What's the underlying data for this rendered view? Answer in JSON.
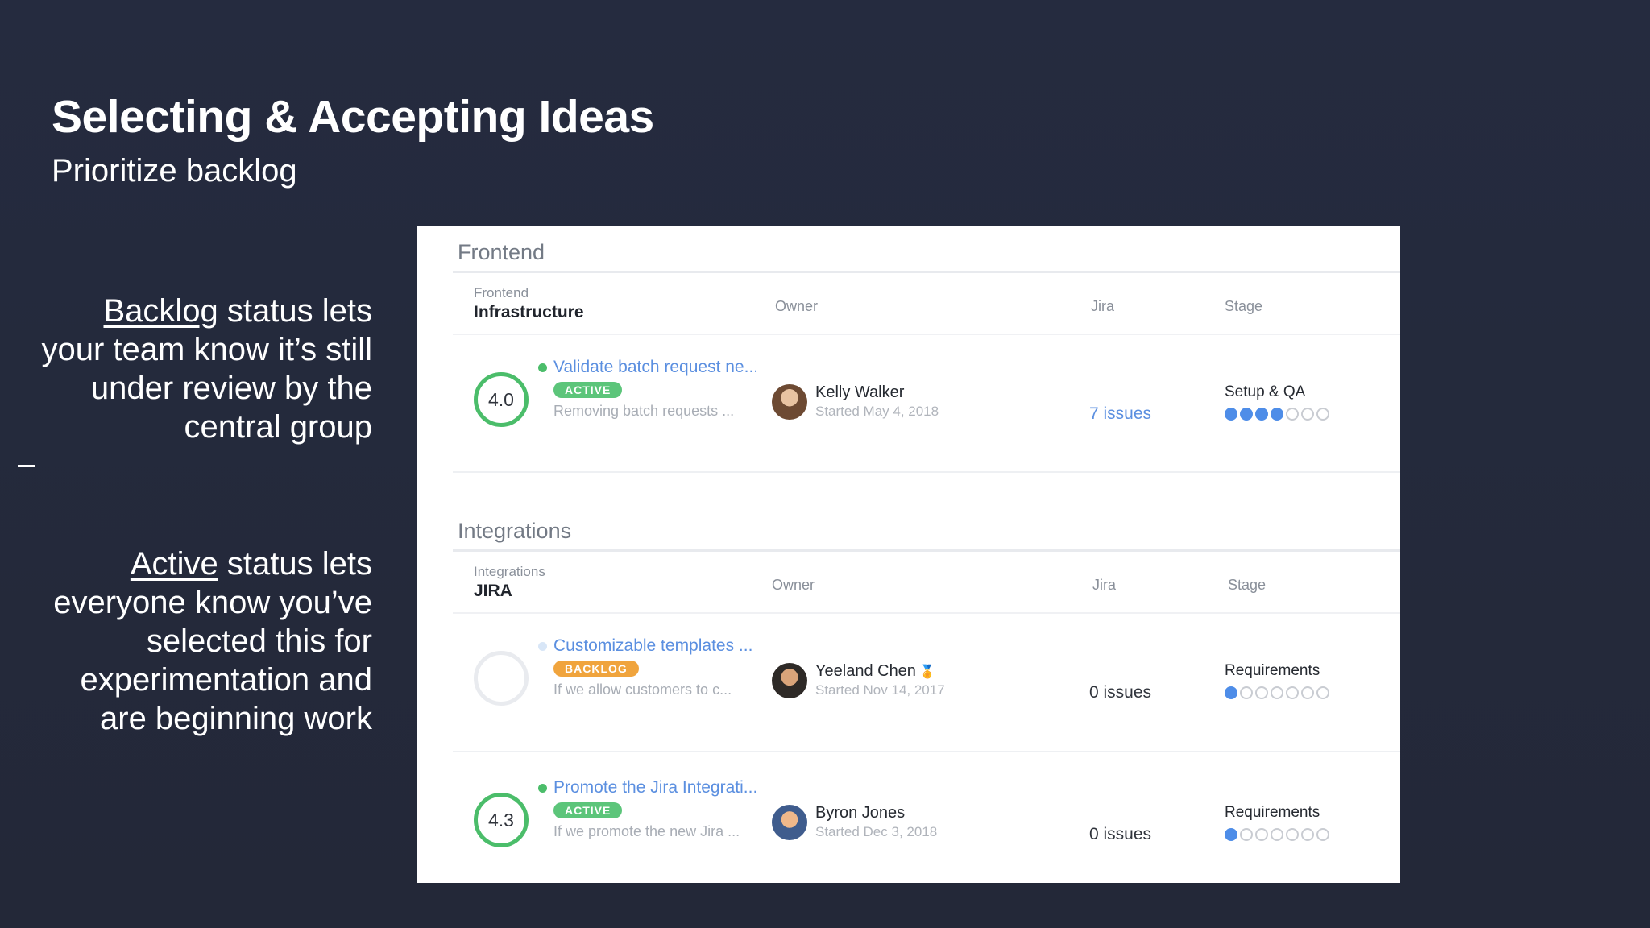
{
  "slide": {
    "title": "Selecting & Accepting Ideas",
    "subtitle": "Prioritize backlog"
  },
  "explanations": {
    "backlog": {
      "keyword": "Backlog",
      "rest": " status lets your team know it’s still under review by the central group"
    },
    "active": {
      "keyword": "Active",
      "rest": " status lets everyone know you’ve selected this for experimentation and are beginning work"
    }
  },
  "columns": {
    "owner": "Owner",
    "jira": "Jira",
    "stage": "Stage"
  },
  "sections": [
    {
      "title": "Frontend",
      "group_label": "Frontend",
      "group_name": "Infrastructure",
      "rows": [
        {
          "score": "4.0",
          "title": "Validate batch request ne...",
          "status": "ACTIVE",
          "description": "Removing batch requests ...",
          "owner": "Kelly Walker",
          "started": "Started May 4, 2018",
          "jira": "7 issues",
          "stage": "Setup & QA",
          "stage_progress": 4,
          "stage_total": 7
        }
      ]
    },
    {
      "title": "Integrations",
      "group_label": "Integrations",
      "group_name": "JIRA",
      "rows": [
        {
          "score": "",
          "title": "Customizable templates ...",
          "status": "BACKLOG",
          "description": "If we allow customers to c...",
          "owner": "Yeeland Chen",
          "started": "Started Nov 14, 2017",
          "jira": "0 issues",
          "stage": "Requirements",
          "stage_progress": 1,
          "stage_total": 7
        },
        {
          "score": "4.3",
          "title": "Promote the Jira Integrati...",
          "status": "ACTIVE",
          "description": "If we promote the new Jira ...",
          "owner": "Byron Jones",
          "started": "Started Dec 3, 2018",
          "jira": "0 issues",
          "stage": "Requirements",
          "stage_progress": 1,
          "stage_total": 7
        }
      ]
    }
  ],
  "colors": {
    "background": "#252b3f",
    "active": "#5cc57a",
    "backlog": "#f0a43d",
    "link": "#5b8fe0",
    "stage_on": "#4e8de8"
  }
}
